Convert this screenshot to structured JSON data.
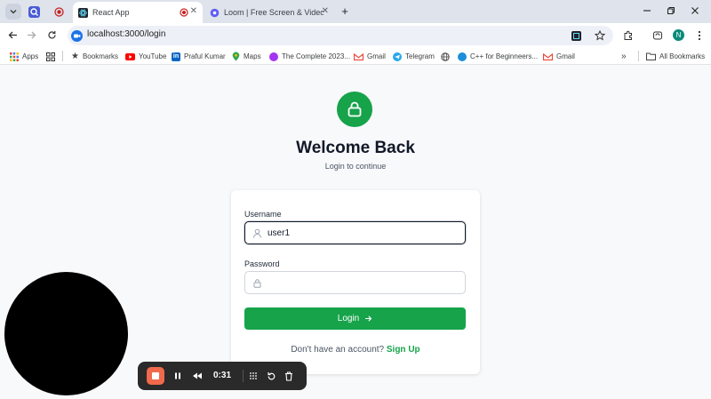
{
  "browser": {
    "tabs": [
      {
        "label": "React App",
        "active": true
      },
      {
        "label": "Loom | Free Screen & Video Re",
        "active": false
      }
    ],
    "new_tab_label": "+",
    "url_host": "localhost",
    "url_path": ":3000/login",
    "profile_initial": "N"
  },
  "bookmarks": {
    "apps": "Apps",
    "items": [
      "Bookmarks",
      "YouTube",
      "Praful Kumar",
      "Maps",
      "The Complete 2023...",
      "Gmail",
      "Telegram",
      "C++ for Beginneers...",
      "Gmail"
    ],
    "overflow": "»",
    "all": "All Bookmarks"
  },
  "login": {
    "title": "Welcome Back",
    "subtitle": "Login to continue",
    "username_label": "Username",
    "username_value": "user1",
    "password_label": "Password",
    "password_value": "",
    "button_label": "Login",
    "signup_prompt": "Don't have an account?",
    "signup_link": "Sign Up"
  },
  "recorder": {
    "time": "0:31"
  },
  "colors": {
    "accent": "#16a34a",
    "record": "#f06a4b"
  }
}
